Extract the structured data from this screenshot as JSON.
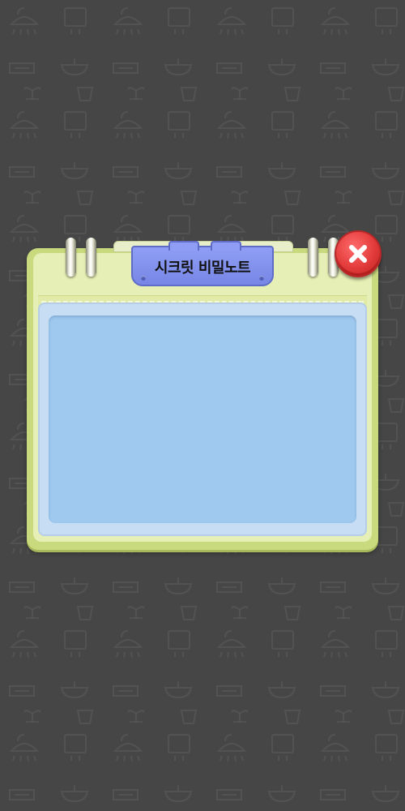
{
  "popup": {
    "title": "시크릿 비밀노트"
  },
  "icons": {
    "close": "close-icon",
    "background": "bathroom-pattern-icons"
  },
  "colors": {
    "background": "#464646",
    "notebook_frame": "#c9d97e",
    "notebook_inner": "#e6efb5",
    "paper": "#c7ddf3",
    "content": "#9fc9ee",
    "title_tab": "#8f9ef4",
    "close_button": "#e23a3a"
  }
}
